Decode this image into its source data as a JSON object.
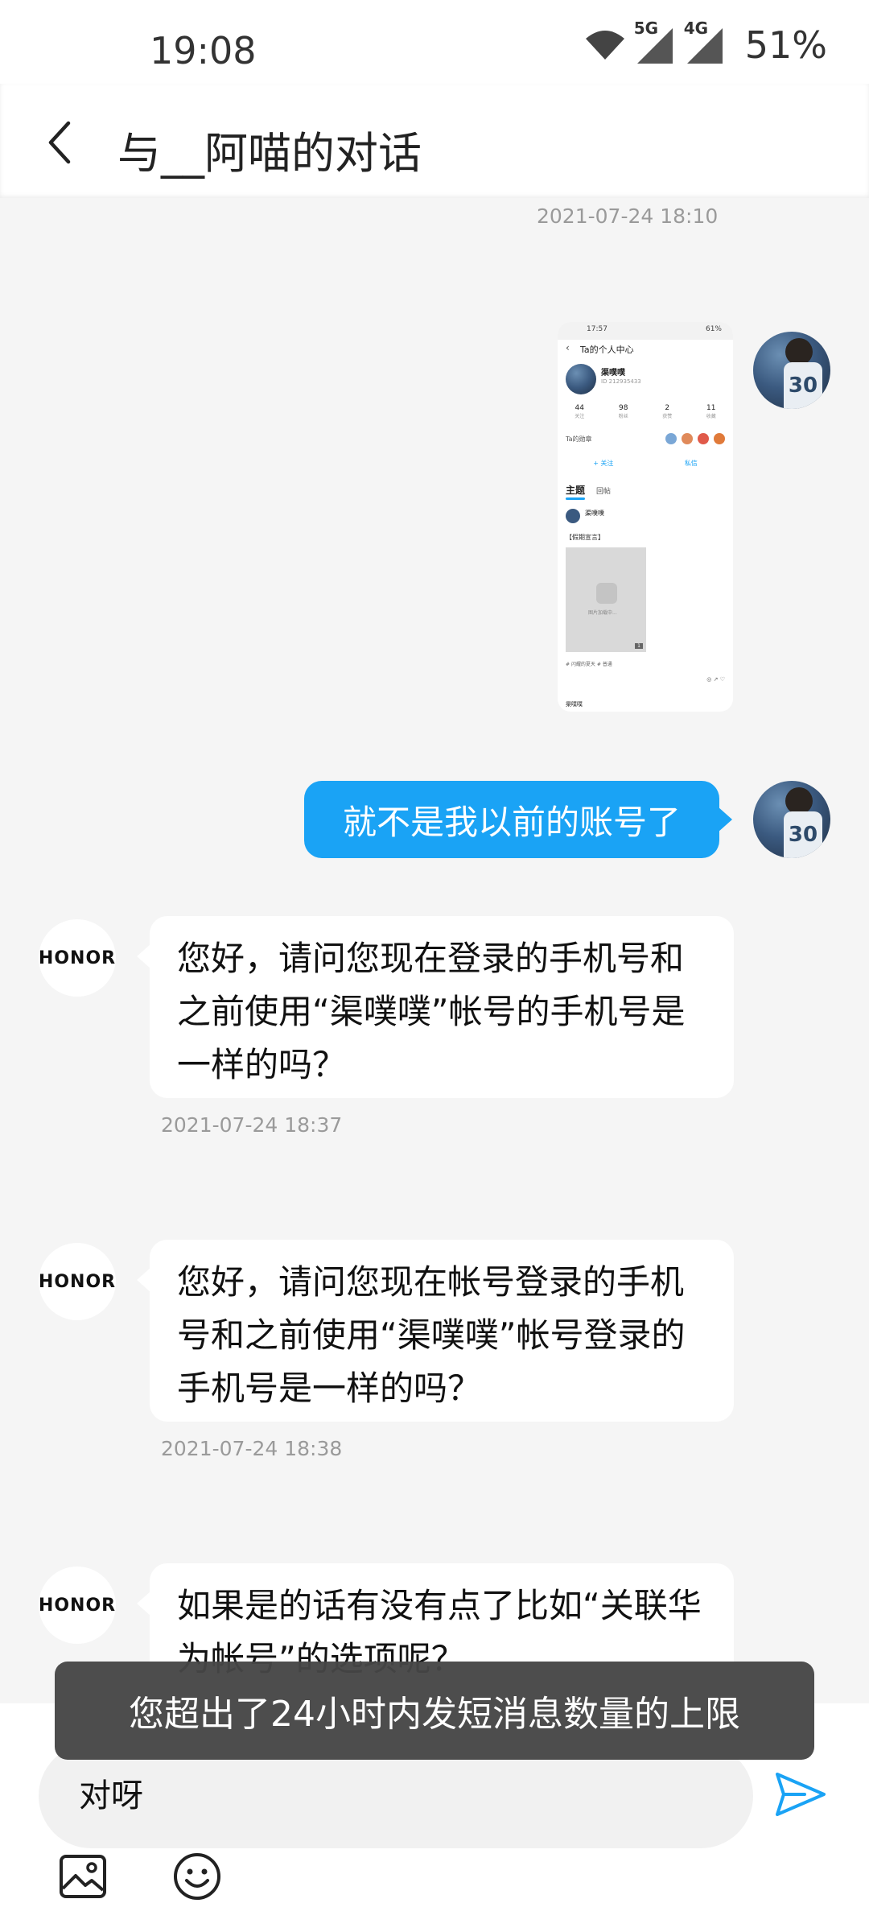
{
  "status_bar": {
    "time": "19:08",
    "net_5g": "5G",
    "net_4g": "4G",
    "battery": "51%"
  },
  "header": {
    "title": "与__阿喵的对话"
  },
  "messages": [
    {
      "type": "timestamp",
      "text": "2021-07-24 18:10"
    },
    {
      "type": "image",
      "from": "me"
    },
    {
      "type": "text",
      "from": "me",
      "text": "就不是我以前的账号了"
    },
    {
      "type": "text",
      "from": "honor",
      "avatar_text": "HONOR",
      "text": "您好，请问您现在登录的手机号和之前使用“渠噗噗”帐号的手机号是一样的吗？",
      "time": "2021-07-24 18:37"
    },
    {
      "type": "text",
      "from": "honor",
      "avatar_text": "HONOR",
      "text": "您好，请问您现在帐号登录的手机号和之前使用“渠噗噗”帐号登录的手机号是一样的吗？",
      "time": "2021-07-24 18:38"
    },
    {
      "type": "text",
      "from": "honor",
      "avatar_text": "HONOR",
      "text": "如果是的话有没有点了比如“关联华为帐号”的选项呢？"
    }
  ],
  "thumbnail": {
    "status_time": "17:57",
    "status_battery": "61%",
    "title": "Ta的个人中心",
    "name": "渠噗噗",
    "sub": "ID 212935433",
    "stats": [
      {
        "value": "44",
        "label": "关注"
      },
      {
        "value": "98",
        "label": "粉丝"
      },
      {
        "value": "2",
        "label": "获赞"
      },
      {
        "value": "11",
        "label": "收藏"
      }
    ],
    "badges_label": "Ta的勋章",
    "follow": "+ 关注",
    "message": "私信",
    "tab_active": "主题",
    "tab_other": "回帖",
    "post_name": "渠噗噗",
    "post_tag": "【假期宣言】",
    "image_caption": "图片加载中...",
    "image_count": "1",
    "chips": "# 闪耀的夏天   # 普通",
    "next_name": "渠噗噗"
  },
  "input": {
    "value": "对呀"
  },
  "toast": {
    "text": "您超出了24小时内发短消息数量的上限"
  },
  "colors": {
    "accent": "#1aa3f5",
    "bubble_in": "#ffffff",
    "background": "#f5f5f5"
  }
}
